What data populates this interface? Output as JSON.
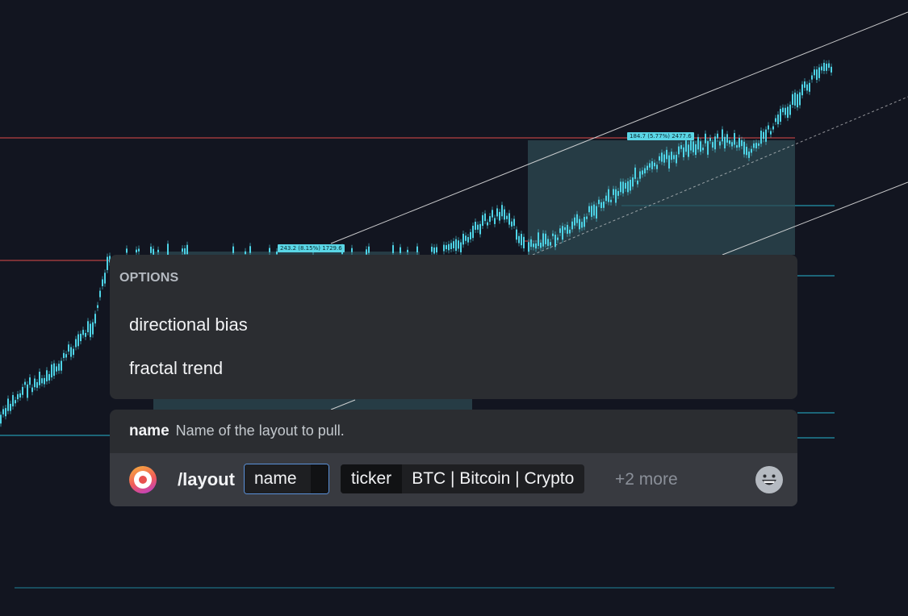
{
  "chart": {
    "measure_label_1": "243.2 (8.15%) 1729.6",
    "measure_label_2": "184.7 (5.77%) 2477.6",
    "colors": {
      "background": "#121520",
      "candle": "#4dd3e6",
      "support_line": "#26b5cf",
      "resistance_line": "#e04a4a",
      "channel_line": "#e8e8e8",
      "measure_box": "#2e4a52"
    }
  },
  "options": {
    "header": "OPTIONS",
    "items": [
      {
        "label": "directional bias"
      },
      {
        "label": "fractal trend"
      }
    ]
  },
  "param_hint": {
    "name": "name",
    "description": "Name of the layout to pull."
  },
  "command": {
    "name": "/layout",
    "avatar_icon": "app-logo-icon",
    "name_param_label": "name",
    "ticker_param_label": "ticker",
    "ticker_param_value": "BTC | Bitcoin | Crypto",
    "more_label": "+2 more",
    "emoji_icon": "grinning-face-icon"
  }
}
